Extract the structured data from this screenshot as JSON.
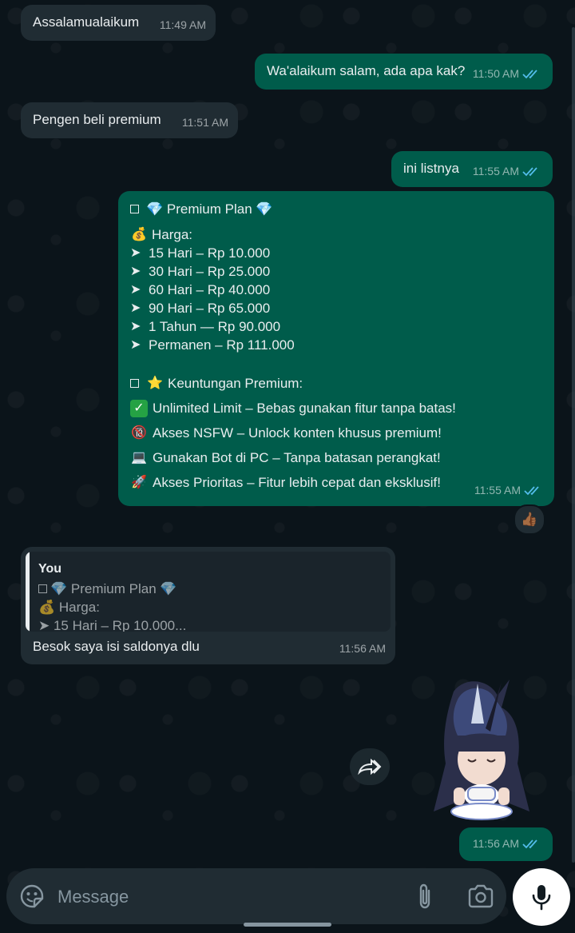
{
  "messages": [
    {
      "text": "Assalamualaikum",
      "time": "11:49 AM"
    },
    {
      "text": "Wa'alaikum salam, ada apa kak?",
      "time": "11:50 AM"
    },
    {
      "text": "Pengen beli premium",
      "time": "11:51 AM"
    },
    {
      "text": "ini listnya",
      "time": "11:55 AM"
    }
  ],
  "plan_message": {
    "title": "💎 Premium Plan 💎",
    "price_label": "Harga:",
    "prices": [
      "15 Hari – Rp 10.000",
      "30 Hari – Rp 25.000",
      "60 Hari – Rp 40.000",
      "90 Hari – Rp 65.000",
      "1 Tahun — Rp 90.000",
      "Permanen – Rp 111.000"
    ],
    "benefits_title": "Keuntungan Premium:",
    "benefits": [
      {
        "icon": "check-box-icon",
        "text": "Unlimited Limit – Bebas gunakan fitur tanpa batas!"
      },
      {
        "icon": "no-under-18-icon",
        "text": "Akses NSFW – Unlock konten khusus premium!"
      },
      {
        "icon": "laptop-icon",
        "text": "Gunakan Bot di PC – Tanpa batasan perangkat!"
      },
      {
        "icon": "rocket-icon",
        "text": "Akses Prioritas – Fitur lebih cepat dan eksklusif!"
      }
    ],
    "time": "11:55 AM",
    "reaction": "👍🏾"
  },
  "reply_message": {
    "quote_author": "You",
    "quote_lines": [
      "💎 Premium Plan 💎",
      "💰 Harga:",
      "➤ 15 Hari – Rp 10.000..."
    ],
    "text": "Besok saya isi saldonya dlu",
    "time": "11:56 AM"
  },
  "sticker_message": {
    "time": "11:56 AM"
  },
  "composer": {
    "placeholder": "Message"
  },
  "colors": {
    "incoming": "#202c33",
    "outgoing": "#005c4b",
    "background": "#0b141a",
    "read_ticks": "#53bdeb"
  }
}
